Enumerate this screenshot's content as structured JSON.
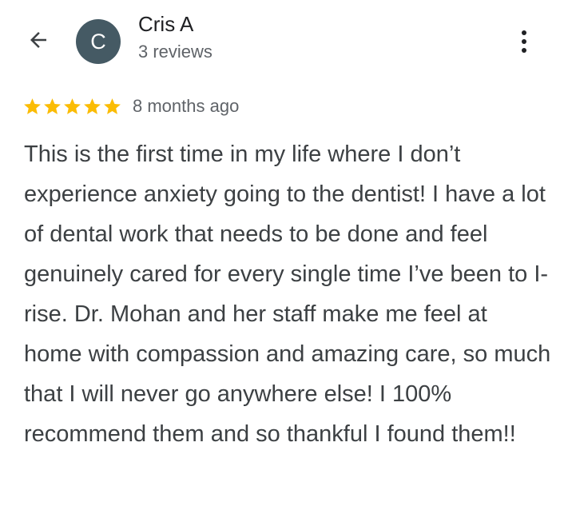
{
  "header": {
    "author_initial": "C",
    "author_name": "Cris A",
    "review_count": "3 reviews"
  },
  "icons": {
    "back": "arrow-back-icon",
    "more": "more-vert-icon",
    "star": "star-icon"
  },
  "review": {
    "rating": 5,
    "rating_max": 5,
    "date": "8 months ago",
    "text": "This is the first time in my life where I don’t experience anxiety going to the dentist! I have a lot of dental work that needs to be done and feel genuinely cared for every single time I’ve been to I-rise. Dr. Mohan and her staff make me feel at home with compassion and amazing care, so much that I will never go anywhere else! I 100% recommend them and so thankful I found them!!"
  },
  "colors": {
    "avatar_bg": "#455a64",
    "star": "#fbbc04",
    "primary_text": "#202124",
    "secondary_text": "#5f6368",
    "body_text": "#3c4043"
  }
}
